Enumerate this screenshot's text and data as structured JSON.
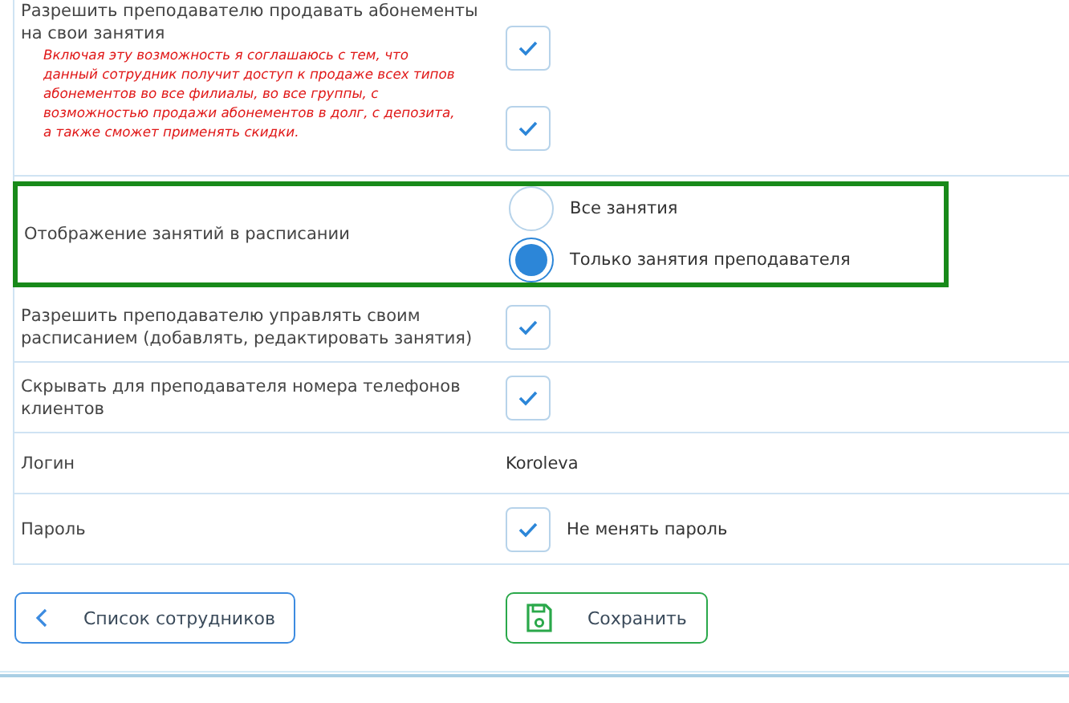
{
  "rows": [
    {
      "kind": "checkbox",
      "label": "Разрешить преподавателю продавать абонементы на свои занятия",
      "note": "Включая эту возможность я соглашаюсь с тем, что данный сотрудник получит доступ к продаже всех типов абонементов во все филиалы, во все группы, с возможностью продажи абонементов в долг, с депозита, а также сможет применять скидки.",
      "checks": [
        {
          "checked": true
        },
        {
          "checked": true
        }
      ],
      "highlighted": false
    },
    {
      "kind": "radio",
      "label": "Отображение занятий в расписании",
      "options": [
        {
          "label": "Все занятия",
          "selected": false
        },
        {
          "label": "Только занятия преподавателя",
          "selected": true
        }
      ],
      "highlighted": true
    },
    {
      "kind": "checkbox",
      "label": "Разрешить преподавателю управлять своим расписанием (добавлять, редактировать занятия)",
      "checks": [
        {
          "checked": true
        }
      ],
      "highlighted": false
    },
    {
      "kind": "checkbox",
      "label": "Скрывать для преподавателя номера телефонов клиентов",
      "checks": [
        {
          "checked": true
        }
      ],
      "highlighted": false
    },
    {
      "kind": "text",
      "label": "Логин",
      "value": "Koroleva",
      "highlighted": false
    },
    {
      "kind": "checkbox",
      "label": "Пароль",
      "checks": [
        {
          "checked": true,
          "label": "Не менять пароль"
        }
      ],
      "highlighted": false
    }
  ],
  "buttons": [
    {
      "kind": "back",
      "label": "Список сотрудников"
    },
    {
      "kind": "save",
      "label": "Сохранить"
    }
  ]
}
